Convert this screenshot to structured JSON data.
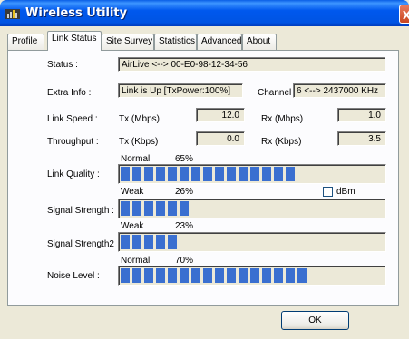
{
  "window": {
    "title": "Wireless Utility"
  },
  "tabs": [
    {
      "label": "Profile"
    },
    {
      "label": "Link Status"
    },
    {
      "label": "Site Survey"
    },
    {
      "label": "Statistics"
    },
    {
      "label": "Advanced"
    },
    {
      "label": "About"
    }
  ],
  "link_status": {
    "status_label": "Status :",
    "status_value": "AirLive <--> 00-E0-98-12-34-56",
    "extra_info_label": "Extra Info :",
    "extra_info_value": "Link is Up [TxPower:100%]",
    "channel_label": "Channel :",
    "channel_value": "6 <--> 2437000 KHz",
    "link_speed_label": "Link Speed :",
    "tx_mbps_label": "Tx (Mbps)",
    "tx_mbps_value": "12.0",
    "rx_mbps_label": "Rx (Mbps)",
    "rx_mbps_value": "1.0",
    "throughput_label": "Throughput :",
    "tx_kbps_label": "Tx (Kbps)",
    "tx_kbps_value": "0.0",
    "rx_kbps_label": "Rx (Kbps)",
    "rx_kbps_value": "3.5",
    "link_quality": {
      "label": "Link Quality :",
      "word": "Normal",
      "percent_text": "65%",
      "level": 0.65
    },
    "signal_strength": {
      "label": "Signal Strength :",
      "word": "Weak",
      "percent_text": "26%",
      "level": 0.26
    },
    "signal_strength2": {
      "label": "Signal Strength2",
      "word": "Weak",
      "percent_text": "23%",
      "level": 0.23
    },
    "noise_level": {
      "label": "Noise Level :",
      "word": "Normal",
      "percent_text": "70%",
      "level": 0.7
    },
    "dbm_label": "dBm",
    "dbm_checked": false
  },
  "ok_label": "OK",
  "colors": {
    "bar_fill": "#3a6fd0",
    "title_bar": "#0054e3"
  }
}
